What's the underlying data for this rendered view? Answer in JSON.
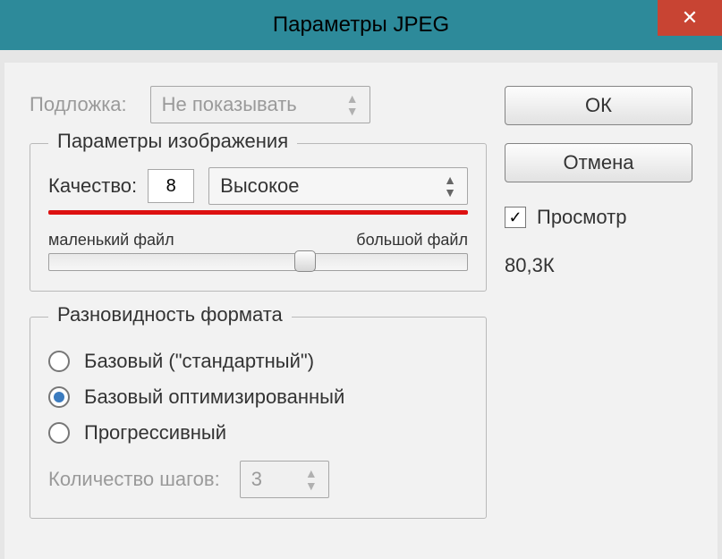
{
  "title": "Параметры JPEG",
  "matte": {
    "label": "Подложка:",
    "value": "Не показывать"
  },
  "buttons": {
    "ok": "ОК",
    "cancel": "Отмена"
  },
  "preview": {
    "label": "Просмотр",
    "checked": true
  },
  "filesize": "80,3К",
  "image_options": {
    "group_title": "Параметры изображения",
    "quality_label": "Качество:",
    "quality_value": "8",
    "quality_preset": "Высокое",
    "slider": {
      "min_label": "маленький файл",
      "max_label": "большой файл",
      "pos_percent": 61
    }
  },
  "format_options": {
    "group_title": "Разновидность формата",
    "radios": {
      "baseline": "Базовый (\"стандартный\")",
      "optimized": "Базовый оптимизированный",
      "progressive": "Прогрессивный"
    },
    "selected": "optimized",
    "steps_label": "Количество шагов:",
    "steps_value": "3"
  }
}
